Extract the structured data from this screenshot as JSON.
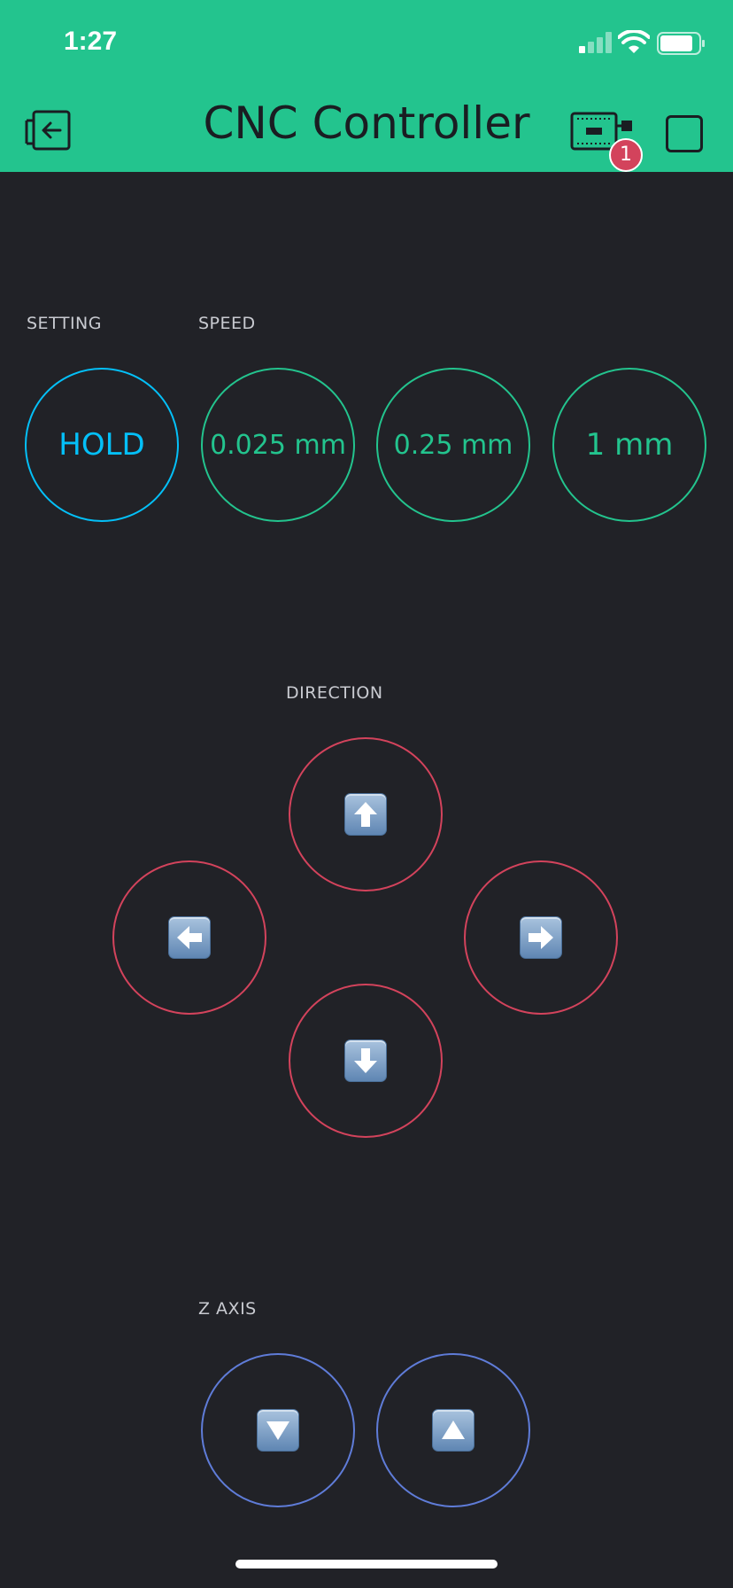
{
  "status_bar": {
    "time": "1:27"
  },
  "header": {
    "title": "CNC Controller",
    "badge_count": "1"
  },
  "labels": {
    "setting": "SETTING",
    "speed": "SPEED",
    "direction": "DIRECTION",
    "z_axis": "Z AXIS"
  },
  "setting_button": {
    "label": "HOLD"
  },
  "speed_buttons": [
    "0.025 mm",
    "0.25 mm",
    "1 mm"
  ],
  "direction_icons": [
    "arrow-up-icon",
    "arrow-left-icon",
    "arrow-right-icon",
    "arrow-down-icon"
  ],
  "z_axis_icons": [
    "triangle-down-icon",
    "triangle-up-icon"
  ],
  "colors": {
    "header": "#23c48e",
    "background": "#212227",
    "setting": "#04c0f8",
    "speed": "#23c48e",
    "direction": "#d3435c",
    "z_axis": "#5f7cd8"
  }
}
